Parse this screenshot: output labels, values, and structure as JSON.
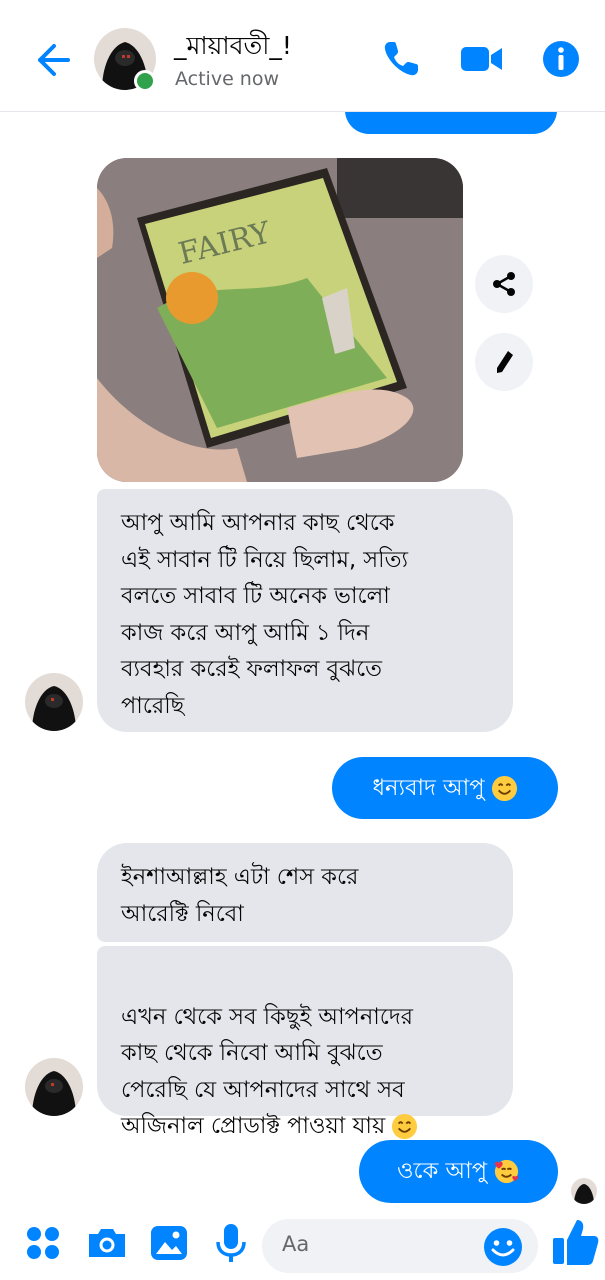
{
  "header": {
    "contact_name": "_মায়াবতী_!",
    "status": "Active now",
    "back_icon": "arrow-left-icon",
    "call_icon": "phone-icon",
    "video_icon": "video-camera-icon",
    "info_icon": "info-icon",
    "accent_color": "#0084ff"
  },
  "messages": [
    {
      "id": "m1",
      "from": "contact",
      "type": "image",
      "image_text": "FAIRY"
    },
    {
      "id": "m2",
      "from": "contact",
      "type": "text",
      "text": "আপু আমি আপনার কাছ থেকে\nএই সাবান টি নিয়ে ছিলাম, সত্যি\nবলতে সাবাব টি অনেক ভালো\nকাজ করে আপু আমি ১ দিন\nব্যবহার করেই ফলাফল বুঝতে\nপারেছি"
    },
    {
      "id": "m3",
      "from": "me",
      "type": "text",
      "text": "ধন্যবাদ আপু",
      "emoji": "smiling-face-icon"
    },
    {
      "id": "m4",
      "from": "contact",
      "type": "text",
      "text": "ইনশাআল্লাহ এটা শেস করে\nআরেক্টি নিবো"
    },
    {
      "id": "m5",
      "from": "contact",
      "type": "text",
      "text": "এখন থেকে সব কিছুই আপনাদের\nকাছ থেকে নিবো আমি বুঝতে\nপেরেছি যে আপনাদের সাথে সব\nঅজিনাল প্রোডাক্ট পাওয়া যায়",
      "emoji": "smiling-face-icon"
    },
    {
      "id": "m6",
      "from": "me",
      "type": "text",
      "text": "ওকে আপু",
      "emoji": "smiling-face-with-hearts-icon"
    }
  ],
  "image_actions": {
    "share_icon": "share-icon",
    "edit_icon": "pencil-icon"
  },
  "composer": {
    "placeholder": "Aa",
    "icons": [
      "menu-dots-icon",
      "camera-icon",
      "image-gallery-icon",
      "microphone-icon",
      "emoji-icon",
      "thumbs-up-icon"
    ]
  }
}
